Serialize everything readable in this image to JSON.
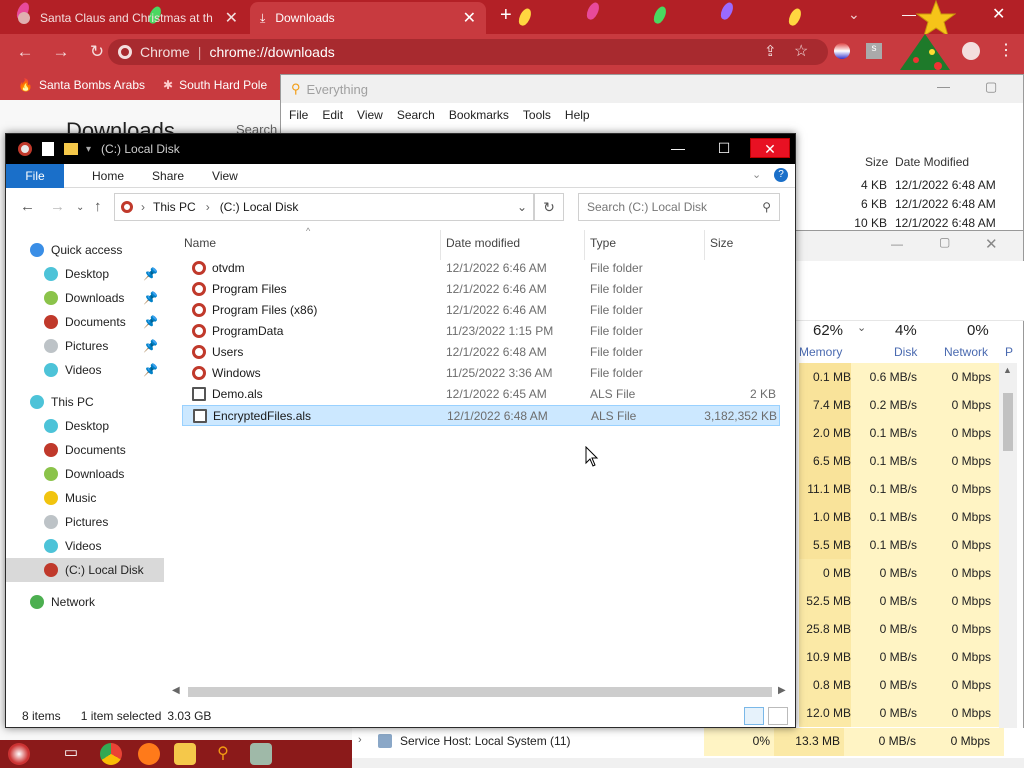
{
  "chrome": {
    "tab1_title": "Santa Claus and Christmas at th",
    "tab2_title": "Downloads",
    "omnibox_site": "Chrome",
    "omnibox_url": "chrome://downloads",
    "bookmarks": [
      "Santa Bombs Arabs",
      "South Hard Pole"
    ],
    "downloads_heading": "Downloads",
    "downloads_search": "Search"
  },
  "everything": {
    "title": "Everything",
    "menu": [
      "File",
      "Edit",
      "View",
      "Search",
      "Bookmarks",
      "Tools",
      "Help"
    ],
    "columns": {
      "size": "Size",
      "date": "Date Modified"
    },
    "rows": [
      {
        "size": "4 KB",
        "date": "12/1/2022 6:48 AM"
      },
      {
        "size": "6 KB",
        "date": "12/1/2022 6:48 AM"
      },
      {
        "size": "10 KB",
        "date": "12/1/2022 6:48 AM"
      }
    ]
  },
  "task_manager": {
    "headers": {
      "memory_pct": "62%",
      "memory_label": "Memory",
      "disk_pct": "4%",
      "disk_label": "Disk",
      "network_pct": "0%",
      "network_label": "Network",
      "extra_label": "P"
    },
    "rows": [
      {
        "memory": "0.1 MB",
        "disk": "0.6 MB/s",
        "network": "0 Mbps"
      },
      {
        "memory": "7.4 MB",
        "disk": "0.2 MB/s",
        "network": "0 Mbps"
      },
      {
        "memory": "2.0 MB",
        "disk": "0.1 MB/s",
        "network": "0 Mbps"
      },
      {
        "memory": "6.5 MB",
        "disk": "0.1 MB/s",
        "network": "0 Mbps"
      },
      {
        "memory": "11.1 MB",
        "disk": "0.1 MB/s",
        "network": "0 Mbps"
      },
      {
        "memory": "1.0 MB",
        "disk": "0.1 MB/s",
        "network": "0 Mbps"
      },
      {
        "memory": "5.5 MB",
        "disk": "0.1 MB/s",
        "network": "0 Mbps"
      },
      {
        "memory": "0 MB",
        "disk": "0 MB/s",
        "network": "0 Mbps"
      },
      {
        "memory": "52.5 MB",
        "disk": "0 MB/s",
        "network": "0 Mbps"
      },
      {
        "memory": "25.8 MB",
        "disk": "0 MB/s",
        "network": "0 Mbps"
      },
      {
        "memory": "10.9 MB",
        "disk": "0 MB/s",
        "network": "0 Mbps"
      },
      {
        "memory": "0.8 MB",
        "disk": "0 MB/s",
        "network": "0 Mbps"
      },
      {
        "memory": "12.0 MB",
        "disk": "0 MB/s",
        "network": "0 Mbps"
      },
      {
        "memory": "13.3 MB",
        "disk": "0 MB/s",
        "network": "0 Mbps"
      }
    ],
    "bottom_row": {
      "name": "Service Host: Local System (11)",
      "cpu": "0%"
    }
  },
  "explorer": {
    "title": "(C:) Local Disk",
    "ribbon": {
      "file": "File",
      "tabs": [
        "Home",
        "Share",
        "View"
      ]
    },
    "breadcrumb": [
      "This PC",
      "(C:) Local Disk"
    ],
    "search_placeholder": "Search (C:) Local Disk",
    "nav": {
      "quick_access": "Quick access",
      "quick_items": [
        "Desktop",
        "Downloads",
        "Documents",
        "Pictures",
        "Videos"
      ],
      "this_pc": "This PC",
      "pc_items": [
        "Desktop",
        "Documents",
        "Downloads",
        "Music",
        "Pictures",
        "Videos",
        "(C:) Local Disk"
      ],
      "network": "Network"
    },
    "columns": {
      "name": "Name",
      "date": "Date modified",
      "type": "Type",
      "size": "Size"
    },
    "files": [
      {
        "name": "otvdm",
        "date": "12/1/2022 6:46 AM",
        "type": "File folder",
        "size": ""
      },
      {
        "name": "Program Files",
        "date": "12/1/2022 6:46 AM",
        "type": "File folder",
        "size": ""
      },
      {
        "name": "Program Files (x86)",
        "date": "12/1/2022 6:46 AM",
        "type": "File folder",
        "size": ""
      },
      {
        "name": "ProgramData",
        "date": "11/23/2022 1:15 PM",
        "type": "File folder",
        "size": ""
      },
      {
        "name": "Users",
        "date": "12/1/2022 6:48 AM",
        "type": "File folder",
        "size": ""
      },
      {
        "name": "Windows",
        "date": "11/25/2022 3:36 AM",
        "type": "File folder",
        "size": ""
      },
      {
        "name": "Demo.als",
        "date": "12/1/2022 6:45 AM",
        "type": "ALS File",
        "size": "2 KB"
      },
      {
        "name": "EncryptedFiles.als",
        "date": "12/1/2022 6:48 AM",
        "type": "ALS File",
        "size": "3,182,352 KB"
      }
    ],
    "status": {
      "items": "8 items",
      "selected": "1 item selected",
      "size": "3.03 GB"
    }
  },
  "colors": {
    "chrome_red": "#c83a3f",
    "selection": "#cce8ff",
    "close_red": "#e81123"
  }
}
